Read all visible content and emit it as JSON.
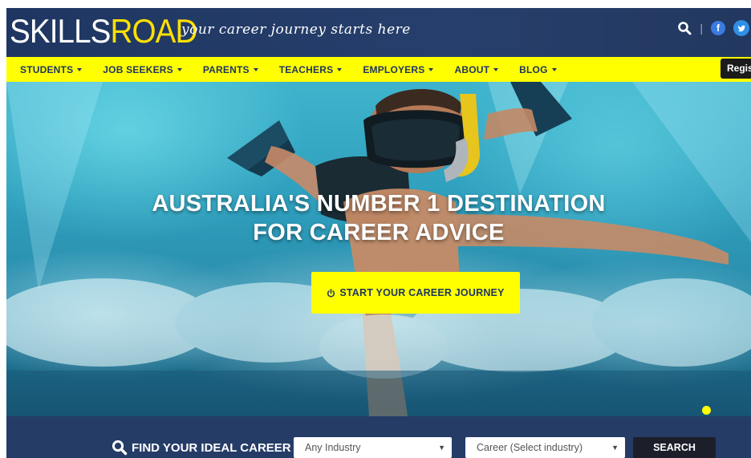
{
  "header": {
    "logo_skills": "SKILLS",
    "logo_road": "ROAD",
    "tagline": "your career journey starts here",
    "divider": "|",
    "facebook_glyph": "f",
    "twitter_glyph": "t",
    "icons": [
      "search-icon",
      "facebook-icon",
      "twitter-icon"
    ]
  },
  "nav": {
    "items": [
      {
        "label": "STUDENTS"
      },
      {
        "label": "JOB SEEKERS"
      },
      {
        "label": "PARENTS"
      },
      {
        "label": "TEACHERS"
      },
      {
        "label": "EMPLOYERS"
      },
      {
        "label": "ABOUT"
      },
      {
        "label": "BLOG"
      }
    ],
    "register_label": "Regis"
  },
  "hero": {
    "title_line1": "AUSTRALIA'S NUMBER 1 DESTINATION",
    "title_line2": "FOR CAREER ADVICE",
    "cta_label": "START YOUR CAREER JOURNEY",
    "cta_icon": "power-icon",
    "carousel_active": 1
  },
  "search": {
    "label": "FIND YOUR IDEAL CAREER",
    "industry_value": "Any Industry",
    "career_value": "Career (Select industry)",
    "button_label": "SEARCH",
    "dropdown_arrow": "▼"
  },
  "colors": {
    "brand_navy": "#243a63",
    "brand_yellow": "#ffff00",
    "hero_water": "#2e9fbd"
  }
}
